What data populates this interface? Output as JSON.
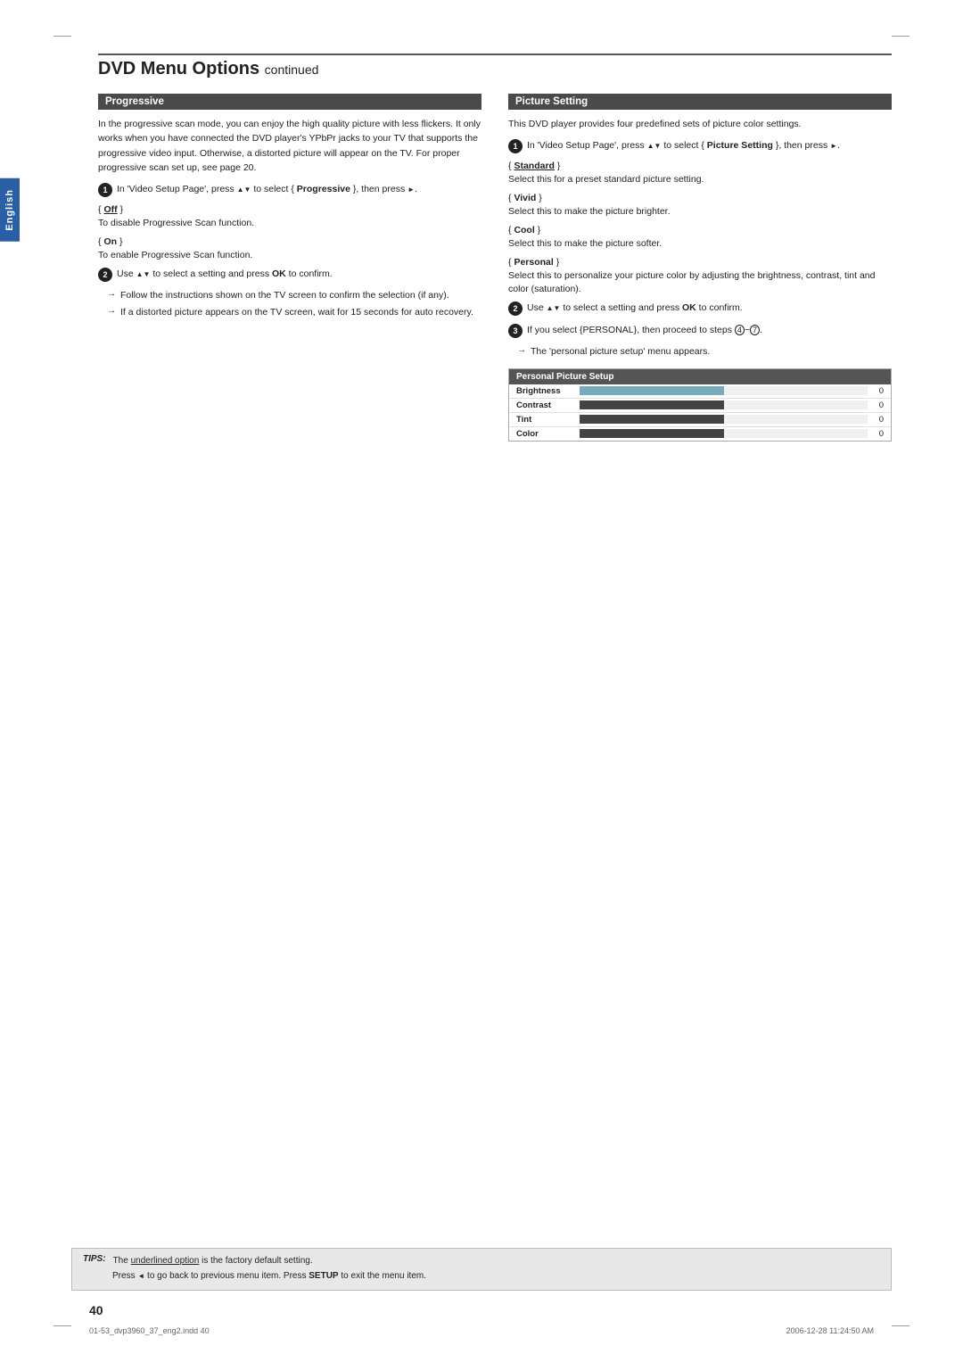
{
  "page": {
    "title": "DVD Menu Options",
    "title_suffix": "continued",
    "page_number": "40",
    "footer_left": "01-53_dvp3960_37_eng2.indd  40",
    "footer_right": "2006-12-28  11:24:50 AM"
  },
  "english_tab": "English",
  "left_column": {
    "section_title": "Progressive",
    "intro_text": "In the progressive scan mode, you can enjoy the high quality picture with less flickers. It only works when you have connected the DVD player's YPbPr jacks to your TV that supports the progressive video input. Otherwise, a distorted picture will appear on the TV. For proper progressive scan set up, see page 20.",
    "step1": {
      "text_before": "In 'Video Setup Page', press",
      "text_mid": "to select {",
      "option": "Progressive",
      "text_after": "}, then press"
    },
    "off_label": "Off",
    "off_desc": "To disable Progressive Scan function.",
    "on_label": "On",
    "on_desc": "To enable Progressive Scan function.",
    "step2_intro": "Use",
    "step2_text": "to select a setting and press",
    "ok_label": "OK",
    "step2_suffix": "to confirm.",
    "arrow1": "Follow the instructions shown on the TV screen to confirm the selection (if any).",
    "arrow2": "If a distorted picture appears on the TV screen, wait for 15 seconds for auto recovery."
  },
  "right_column": {
    "section_title": "Picture Setting",
    "intro_text": "This DVD player provides four predefined sets of picture color settings.",
    "step1": {
      "text_before": "In 'Video Setup Page', press",
      "text_mid": "to select {",
      "option": "Picture Setting",
      "text_after": "}, then press"
    },
    "standard_label": "Standard",
    "standard_desc": "Select this for a preset standard picture setting.",
    "vivid_label": "Vivid",
    "vivid_desc": "Select this to make the picture brighter.",
    "cool_label": "Cool",
    "cool_desc": "Select this to make the picture softer.",
    "personal_label": "Personal",
    "personal_desc": "Select this to personalize your picture color by adjusting the brightness, contrast, tint and color (saturation).",
    "step2_text": "to select a setting and press",
    "ok_label": "OK",
    "step2_suffix": "to confirm.",
    "step3_text": "If you select {PERSONAL}, then proceed to steps",
    "step3_steps": "4~7",
    "arrow1": "The 'personal picture setup' menu appears.",
    "picture_setup": {
      "title": "Personal Picture Setup",
      "rows": [
        {
          "label": "Brightness",
          "value": "0"
        },
        {
          "label": "Contrast",
          "value": "0"
        },
        {
          "label": "Tint",
          "value": "0"
        },
        {
          "label": "Color",
          "value": "0"
        }
      ]
    }
  },
  "tips": {
    "label": "TIPS:",
    "line1": "The underlined option is the factory default setting.",
    "line2_before": "Press",
    "line2_mid": "to go back to previous menu item. Press",
    "line2_setup": "SETUP",
    "line2_after": "to exit the menu item."
  }
}
